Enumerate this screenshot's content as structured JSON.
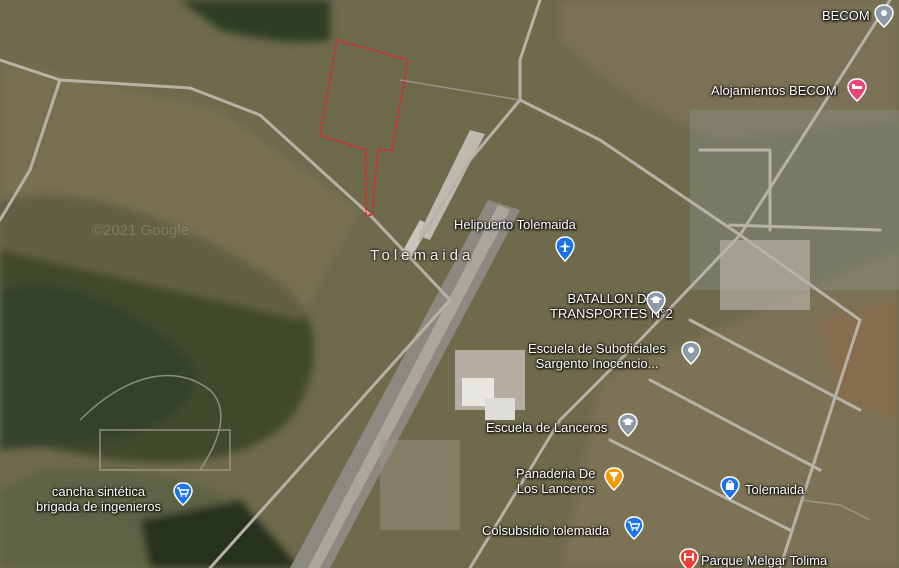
{
  "map": {
    "town_label": "Tolemaida",
    "watermark": "©2021 Google",
    "colors": {
      "terrain": "#6f6a4c",
      "road": "#b7b2a6",
      "plot_outline": "#e0262b",
      "pin_grey": "#8a9aa9",
      "pin_blue": "#1a73e8",
      "pin_pink": "#e8477c",
      "pin_orange": "#f29900",
      "pin_red": "#ea4335"
    },
    "places": [
      {
        "name": "BECOM",
        "icon": "location-pin-icon"
      },
      {
        "name": "Alojamientos BECOM",
        "icon": "bed-icon"
      },
      {
        "name": "Helipuerto Tolemaida",
        "icon": "airplane-icon"
      },
      {
        "name_line1": "BATALLON DE",
        "name_line2": "TRANSPORTES N°2",
        "icon": "school-icon"
      },
      {
        "name_line1": "Escuela de Suboficiales",
        "name_line2": "Sargento Inocencio...",
        "icon": "location-pin-icon"
      },
      {
        "name": "Escuela de Lanceros",
        "icon": "school-icon"
      },
      {
        "name_line1": "Panaderia De",
        "name_line2": "Los Lanceros",
        "icon": "restaurant-icon"
      },
      {
        "name": "Tolemaida",
        "icon": "shopping-bag-icon"
      },
      {
        "name_line1": "cancha sintética",
        "name_line2": "brigada de ingenieros",
        "icon": "shopping-cart-icon"
      },
      {
        "name": "Colsubsidio tolemaida",
        "icon": "shopping-cart-icon"
      },
      {
        "name": "Parque Melgar Tolima",
        "icon": "hospital-icon"
      }
    ]
  }
}
